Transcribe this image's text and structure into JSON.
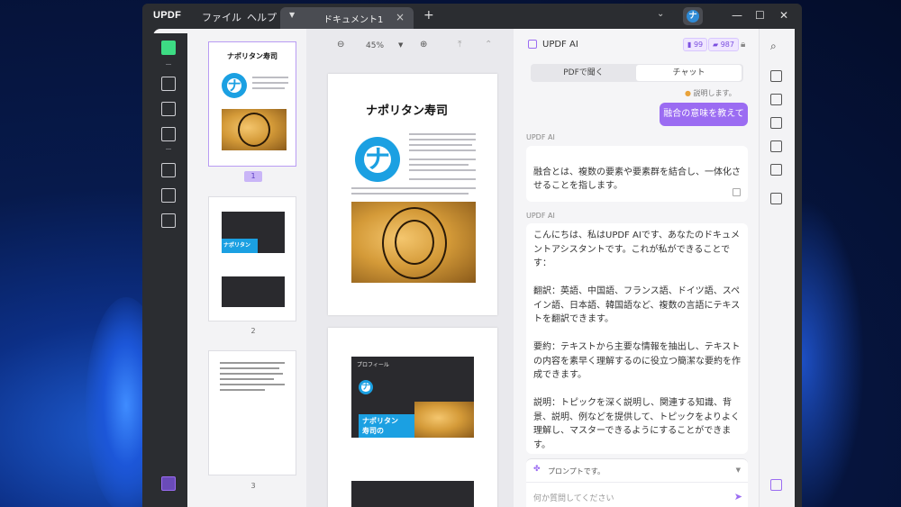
{
  "app": {
    "logo": "UPDF",
    "menu_file": "ファイル",
    "menu_help": "ヘルプ",
    "tab_title": "ドキュメント1",
    "tab_add": "+",
    "tab_close": "×"
  },
  "viewer": {
    "zoom": "45%"
  },
  "thumbnails": {
    "pages": [
      "1",
      "2",
      "3"
    ]
  },
  "doc": {
    "title": "ナポリタン寿司",
    "tako_char": "ナ",
    "page2_title_l1": "ナポリタン",
    "page2_title_l2": "寿司の",
    "page2_heading": "プロフィール"
  },
  "ai": {
    "title": "UPDF AI",
    "credit_a": "99",
    "credit_b": "987",
    "tab_pdf": "PDFで聞く",
    "tab_chat": "チャット",
    "hint": "説明します。",
    "user_message": "融合の意味を教えて",
    "label_1": "UPDF AI",
    "answer_1": "融合とは、複数の要素や要素群を結合し、一体化させることを指します。",
    "label_2": "UPDF AI",
    "answer_2": "こんにちは、私はUPDF AIです、あなたのドキュメントアシスタントです。これが私ができることです：\n\n翻訳：英語、中国語、フランス語、ドイツ語、スペイン語、日本語、韓国語など、複数の言語にテキストを翻訳できます。\n\n要約：テキストから主要な情報を抽出し、テキストの内容を素早く理解するのに役立つ簡潔な要約を作成できます。\n\n説明：トピックを深く説明し、関連する知識、背景、説明、例などを提供して、トピックをよりよく理解し、マスターできるようにすることができます。\n\n書く：仕様を満たし、要件と資料に応じて一貫していて一貫している記事を生成できます。記事、レポート、プレスリリース、広告コピーなど、さまざまな場面で使用できます。",
    "prompt_label": "プロンプトです。",
    "input_placeholder": "何か質問してください"
  },
  "colors": {
    "accent": "#9b6cf2",
    "active_tool": "#3ddc84",
    "brand_blue": "#1ba0e2"
  }
}
